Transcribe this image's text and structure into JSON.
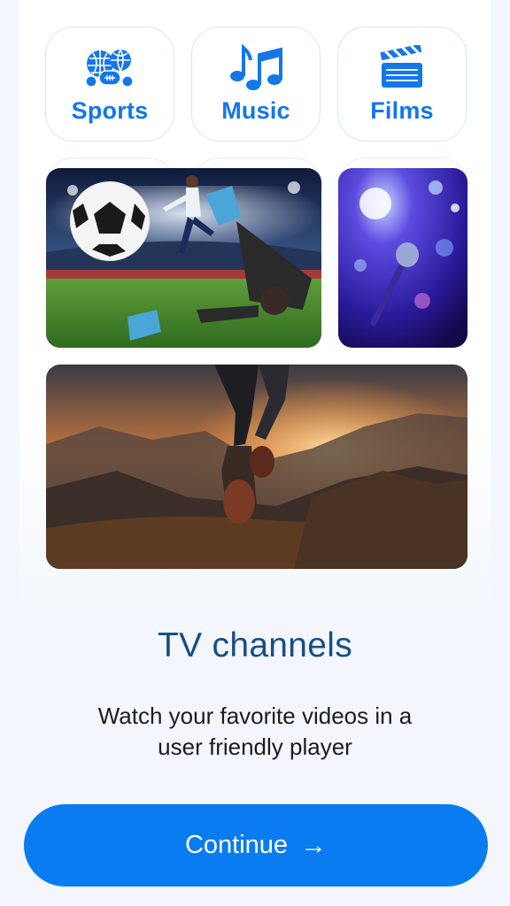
{
  "categories": [
    {
      "label": "Sports",
      "icon": "sports-balls-icon"
    },
    {
      "label": "Music",
      "icon": "music-notes-icon"
    },
    {
      "label": "Films",
      "icon": "clapperboard-icon"
    }
  ],
  "onboarding": {
    "title": "TV channels",
    "subtitle": "Watch your favorite videos in a user friendly player"
  },
  "continue_button": {
    "label": "Continue",
    "icon": "arrow-right-icon"
  },
  "colors": {
    "accent": "#0a7cf2",
    "title": "#164f86",
    "category_label": "#1377e8"
  }
}
